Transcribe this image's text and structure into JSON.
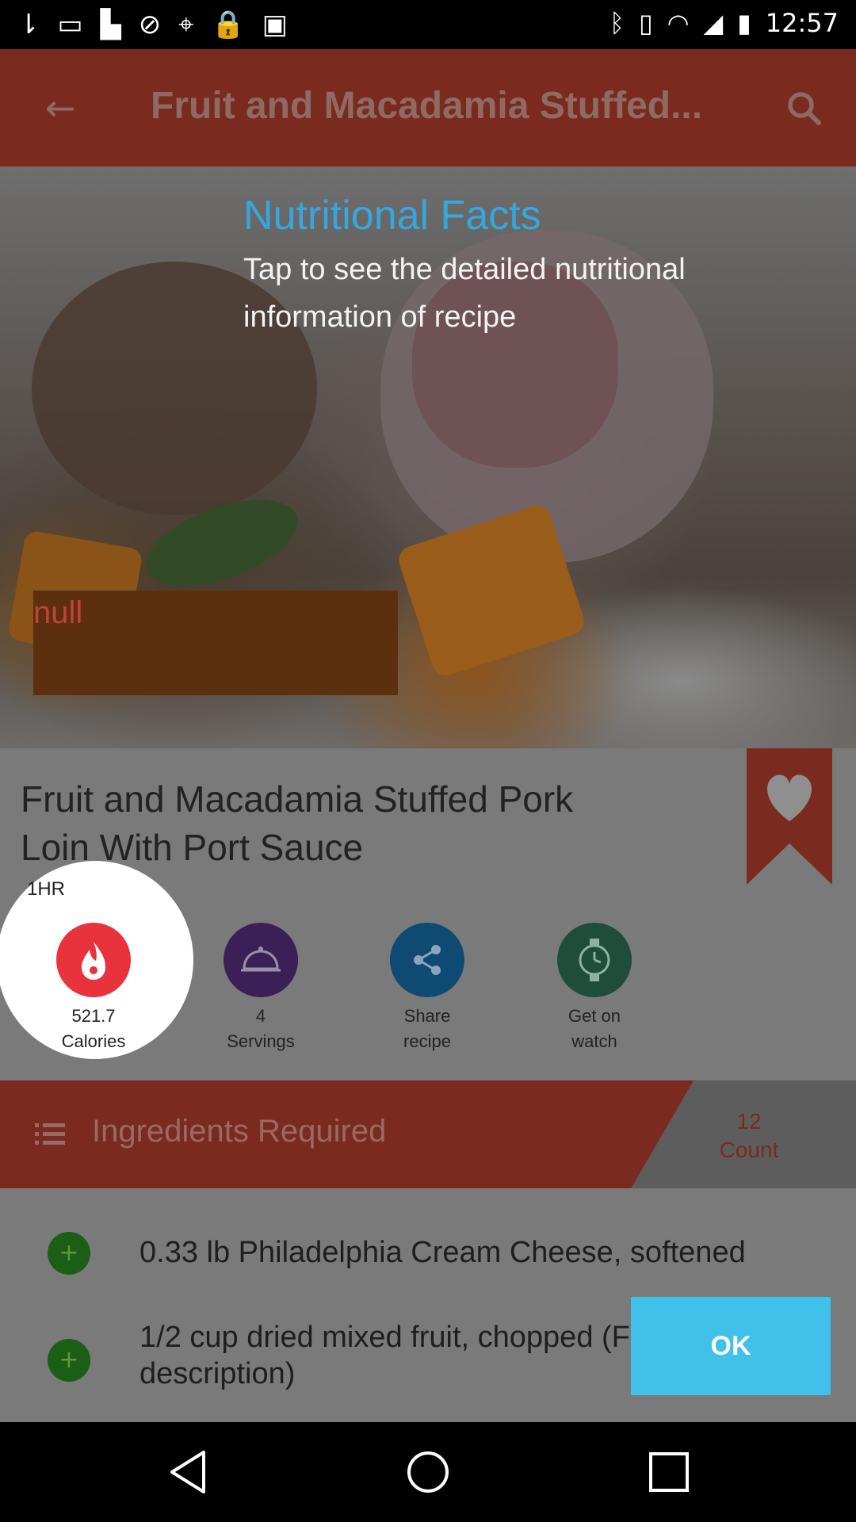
{
  "status_bar": {
    "left_icons": [
      "notification-icon",
      "message-icon",
      "flipboard-icon",
      "blocked-icon",
      "location-off-icon",
      "lock-icon",
      "android-icon"
    ],
    "right_icons": [
      "bluetooth-icon",
      "vibrate-icon",
      "wifi-icon",
      "signal-icon",
      "battery-icon"
    ],
    "time": "12:57"
  },
  "app_bar": {
    "title": "Fruit and Macadamia Stuffed...",
    "back_icon": "←",
    "search_icon": "search-icon"
  },
  "overlay": {
    "title": "Nutritional Facts",
    "text": "Tap to see the detailed nutritional information of recipe",
    "null_label": "null",
    "ok_label": "OK"
  },
  "recipe": {
    "name": "Fruit and Macadamia Stuffed Pork Loin With Port Sauce",
    "duration": "1HR",
    "stats": [
      {
        "icon": "flame-icon",
        "line1": "521.7",
        "line2": "Calories",
        "color": "#e8323c"
      },
      {
        "icon": "serving-dish-icon",
        "line1": "4",
        "line2": "Servings",
        "color": "#3b1f57"
      },
      {
        "icon": "share-icon",
        "line1": "Share",
        "line2": "recipe",
        "color": "#0f4a73"
      },
      {
        "icon": "watch-icon",
        "line1": "Get on",
        "line2": "watch",
        "color": "#1e4d3c"
      }
    ]
  },
  "ingredients": {
    "header": "Ingredients Required",
    "count_value": "12",
    "count_label": "Count",
    "items": [
      {
        "text": "0.33 lb Philadelphia Cream Cheese, softened"
      },
      {
        "text": "1/2 cup dried mixed fruit, chopped (F description)"
      }
    ]
  },
  "colors": {
    "accent_blue": "#33a8e0",
    "brand_red": "#7a2a1f",
    "ok_button": "#3fc1ea"
  }
}
